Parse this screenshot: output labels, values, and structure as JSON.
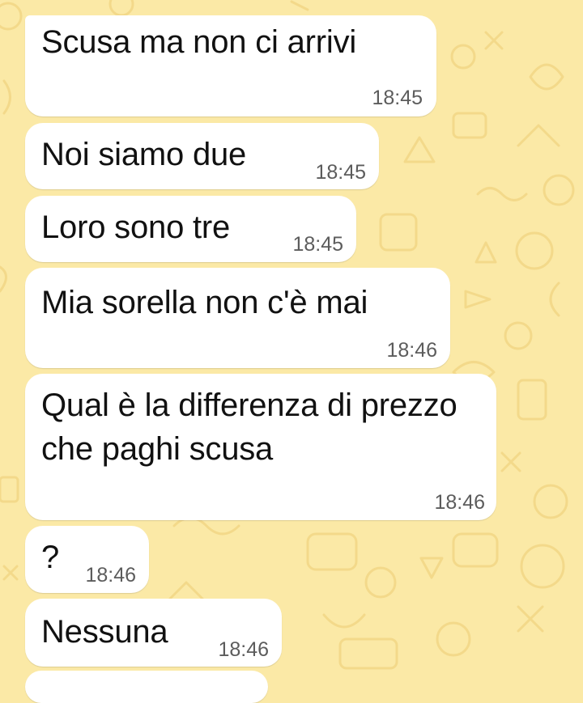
{
  "chat": {
    "background_color": "#fbe9a6",
    "bubble_color": "#ffffff",
    "messages": [
      {
        "text": "Scusa ma non ci arrivi",
        "time": "18:45"
      },
      {
        "text": "Noi siamo due",
        "time": "18:45"
      },
      {
        "text": "Loro sono tre",
        "time": "18:45"
      },
      {
        "text": "Mia sorella non c'è mai",
        "time": "18:46"
      },
      {
        "text": "Qual è la differenza di prezzo che paghi scusa",
        "time": "18:46"
      },
      {
        "text": "?",
        "time": "18:46"
      },
      {
        "text": "Nessuna",
        "time": "18:46"
      }
    ]
  }
}
